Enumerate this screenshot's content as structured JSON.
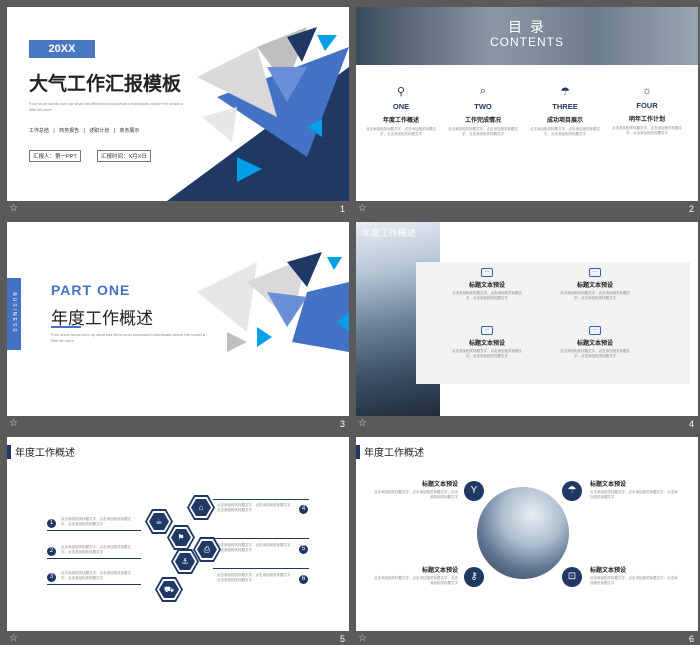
{
  "slides": [
    {
      "number": "1",
      "year_badge": "20XX",
      "title": "大气工作汇报模板",
      "subtitle": "Four short words sum up what has lifted most successful individuals above the crowd a little bit more",
      "tags": [
        "工作总结",
        "商务报告",
        "述职计划",
        "商务展示"
      ],
      "reporter": "汇报人：第一PPT",
      "report_time": "汇报时间：X月X日"
    },
    {
      "number": "2",
      "title": "目 录",
      "title_en": "CONTENTS",
      "items": [
        {
          "icon": "tool-icon",
          "glyph": "⚲",
          "num": "ONE",
          "label": "年度工作概述",
          "desc": "点击添加相关标题文字，点击添加相关标题文字，点击添加相关标题文字"
        },
        {
          "icon": "search-icon",
          "glyph": "⌕",
          "num": "TWO",
          "label": "工作完成情况",
          "desc": "点击添加相关标题文字，点击添加相关标题文字，点击添加相关标题文字"
        },
        {
          "icon": "umbrella-icon",
          "glyph": "☂",
          "num": "THREE",
          "label": "成功项目展示",
          "desc": "点击添加相关标题文字，点击添加相关标题文字，点击添加相关标题文字"
        },
        {
          "icon": "sun-icon",
          "glyph": "☼",
          "num": "FOUR",
          "label": "明年工作计划",
          "desc": "点击添加相关标题文字，点击添加相关标题文字，点击添加相关标题文字"
        }
      ]
    },
    {
      "number": "3",
      "side_label": "BUSINESS",
      "part": "PART ONE",
      "title": "年度工作概述",
      "subtitle": "Four short words sum up what has lifted most successful individuals above the crowd a little bit more"
    },
    {
      "number": "4",
      "header": "年度工作概述",
      "items": [
        {
          "title": "标题文本预设",
          "desc": "点击添加相关标题文字，点击添加相关标题文字，点击添加相关标题文字"
        },
        {
          "title": "标题文本预设",
          "desc": "点击添加相关标题文字，点击添加相关标题文字，点击添加相关标题文字"
        },
        {
          "title": "标题文本预设",
          "desc": "点击添加相关标题文字，点击添加相关标题文字，点击添加相关标题文字"
        },
        {
          "title": "标题文本预设",
          "desc": "点击添加相关标题文字，点击添加相关标题文字，点击添加相关标题文字"
        }
      ]
    },
    {
      "number": "5",
      "header": "年度工作概述",
      "items": [
        {
          "n": "1",
          "desc": "点击添加相关标题文字，点击添加相关标题文字，点击添加相关标题文字"
        },
        {
          "n": "2",
          "desc": "点击添加相关标题文字，点击添加相关标题文字，点击添加相关标题文字"
        },
        {
          "n": "3",
          "desc": "点击添加相关标题文字，点击添加相关标题文字，点击添加相关标题文字"
        },
        {
          "n": "4",
          "desc": "点击添加相关标题文字，点击添加相关标题文字，点击添加相关标题文字"
        },
        {
          "n": "5",
          "desc": "点击添加相关标题文字，点击添加相关标题文字，点击添加相关标题文字"
        },
        {
          "n": "6",
          "desc": "点击添加相关标题文字，点击添加相关标题文字，点击添加相关标题文字"
        }
      ],
      "hex_icons": [
        {
          "name": "cup-icon",
          "glyph": "☕"
        },
        {
          "name": "graduation-cap-icon",
          "glyph": "⌂"
        },
        {
          "name": "flag-icon",
          "glyph": "⚑"
        },
        {
          "name": "printer-icon",
          "glyph": "⎙"
        },
        {
          "name": "fishing-icon",
          "glyph": "⚓"
        },
        {
          "name": "bus-icon",
          "glyph": "⛟"
        }
      ]
    },
    {
      "number": "6",
      "header": "年度工作概述",
      "items": [
        {
          "title": "标题文本预设",
          "desc": "点击添加相关标题文字，点击添加相关标题文字，点击添加相关标题文字",
          "icon": "cocktail-icon",
          "glyph": "Y"
        },
        {
          "title": "标题文本预设",
          "desc": "点击添加相关标题文字，点击添加相关标题文字，点击添加相关标题文字",
          "icon": "umbrella-icon",
          "glyph": "☂"
        },
        {
          "title": "标题文本预设",
          "desc": "点击添加相关标题文字，点击添加相关标题文字，点击添加相关标题文字",
          "icon": "key-icon",
          "glyph": "⚷"
        },
        {
          "title": "标题文本预设",
          "desc": "点击添加相关标题文字，点击添加相关标题文字，点击添加相关标题文字",
          "icon": "unlock-icon",
          "glyph": "⊡"
        }
      ]
    }
  ],
  "colors": {
    "navy": "#1f3864",
    "blue": "#4472c4",
    "bright_blue": "#00a0e9",
    "gray_bg": "#5a5a5a"
  }
}
